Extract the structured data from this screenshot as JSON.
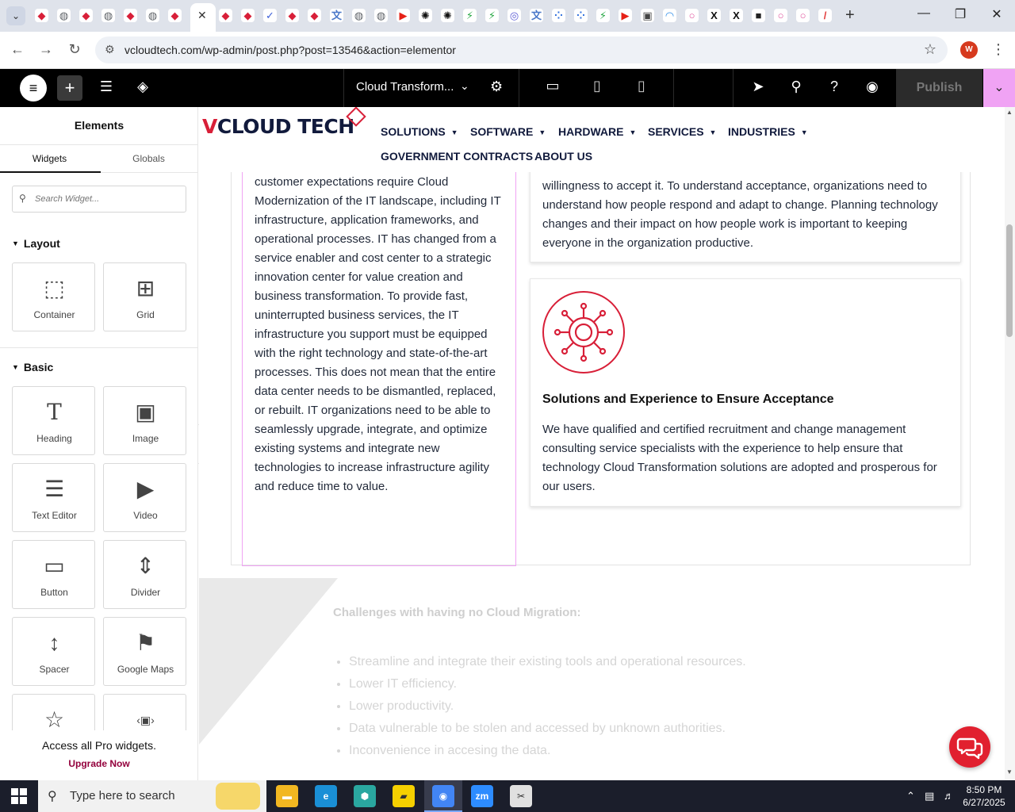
{
  "browser": {
    "url": "vcloudtech.com/wp-admin/post.php?post=13546&action=elementor",
    "profile_initial": "W",
    "tabs_favicons": [
      {
        "icon": "red-diamond-icon",
        "color": "#d81f38"
      },
      {
        "icon": "globe-icon",
        "color": "#5f6368"
      },
      {
        "icon": "red-diamond-icon",
        "color": "#d81f38"
      },
      {
        "icon": "globe-icon",
        "color": "#5f6368"
      },
      {
        "icon": "red-diamond-icon",
        "color": "#d81f38"
      },
      {
        "icon": "globe-icon",
        "color": "#5f6368"
      },
      {
        "icon": "red-diamond-icon",
        "color": "#d81f38"
      },
      {
        "icon": "red-diamond-icon",
        "color": "#d81f38"
      },
      {
        "icon": "red-diamond-icon",
        "color": "#d81f38"
      },
      {
        "icon": "check-icon",
        "color": "#3b5ed9"
      },
      {
        "icon": "red-diamond-icon",
        "color": "#d81f38"
      },
      {
        "icon": "red-diamond-icon",
        "color": "#d81f38"
      },
      {
        "icon": "translate-icon",
        "color": "#4a78c9"
      },
      {
        "icon": "globe-icon",
        "color": "#5f6368"
      },
      {
        "icon": "globe-icon",
        "color": "#5f6368"
      },
      {
        "icon": "youtube-icon",
        "color": "#e62117"
      },
      {
        "icon": "openai-icon",
        "color": "#111111"
      },
      {
        "icon": "openai-icon",
        "color": "#111111"
      },
      {
        "icon": "bolt-icon",
        "color": "#27a844"
      },
      {
        "icon": "bolt-icon",
        "color": "#27a844"
      },
      {
        "icon": "swirl-icon",
        "color": "#5b5bd6"
      },
      {
        "icon": "translate-icon",
        "color": "#4a78c9"
      },
      {
        "icon": "dots-icon",
        "color": "#2f6fde"
      },
      {
        "icon": "dots-icon",
        "color": "#2f6fde"
      },
      {
        "icon": "bolt-icon",
        "color": "#27a844"
      },
      {
        "icon": "youtube-icon",
        "color": "#e62117"
      },
      {
        "icon": "lock-icon",
        "color": "#444444"
      },
      {
        "icon": "arc-icon",
        "color": "#2d8ce8"
      },
      {
        "icon": "ring-icon",
        "color": "#e04f9c"
      },
      {
        "icon": "x-icon",
        "color": "#111111"
      },
      {
        "icon": "x-icon",
        "color": "#111111"
      },
      {
        "icon": "square-logo-icon",
        "color": "#222222"
      },
      {
        "icon": "ring-icon",
        "color": "#e04f9c"
      },
      {
        "icon": "ring-icon",
        "color": "#e04f9c"
      },
      {
        "icon": "slash-icon",
        "color": "#e23b3b"
      }
    ]
  },
  "editor": {
    "document_name": "Cloud Transform...",
    "publish_label": "Publish"
  },
  "panel": {
    "title": "Elements",
    "tabs": [
      "Widgets",
      "Globals"
    ],
    "search_placeholder": "Search Widget...",
    "sections": [
      {
        "label": "Layout",
        "widgets": [
          {
            "label": "Container",
            "icon": "container-icon"
          },
          {
            "label": "Grid",
            "icon": "grid-icon"
          }
        ]
      },
      {
        "label": "Basic",
        "widgets": [
          {
            "label": "Heading",
            "icon": "heading-icon"
          },
          {
            "label": "Image",
            "icon": "image-icon"
          },
          {
            "label": "Text Editor",
            "icon": "text-editor-icon"
          },
          {
            "label": "Video",
            "icon": "video-icon"
          },
          {
            "label": "Button",
            "icon": "button-icon"
          },
          {
            "label": "Divider",
            "icon": "divider-icon"
          },
          {
            "label": "Spacer",
            "icon": "spacer-icon"
          },
          {
            "label": "Google Maps",
            "icon": "google-maps-icon"
          }
        ]
      }
    ],
    "pro_text": "Access all Pro widgets.",
    "upgrade_label": "Upgrade Now"
  },
  "site": {
    "brand_v": "V",
    "brand_rest": "CLOUD TECH",
    "menu": [
      {
        "label": "SOLUTIONS",
        "has_caret": true
      },
      {
        "label": "SOFTWARE",
        "has_caret": true
      },
      {
        "label": "HARDWARE",
        "has_caret": true
      },
      {
        "label": "SERVICES",
        "has_caret": true
      },
      {
        "label": "INDUSTRIES",
        "has_caret": true
      },
      {
        "label": "GOVERNMENT CONTRACTS",
        "has_caret": false
      },
      {
        "label": "ABOUT US",
        "has_caret": false
      }
    ],
    "left_text": "customer expectations require Cloud Modernization of the IT landscape, including IT infrastructure, application frameworks, and operational processes. IT has changed from a service enabler and cost center to a strategic innovation center for value creation and business transformation. To provide fast, uninterrupted business services, the IT infrastructure you support must be equipped with the right technology and state-of-the-art processes. This does not mean that the entire data center needs to be dismantled, replaced, or rebuilt. IT organizations need to be able to seamlessly upgrade, integrate, and optimize existing systems and integrate new technologies to increase infrastructure agility and reduce time to value.",
    "card1_text": "willingness to accept it. To understand acceptance, organizations need to understand how people respond and adapt to change. Planning technology changes and their impact on how people work is important to keeping everyone in the organization productive.",
    "card2_title": "Solutions and Experience to Ensure Acceptance",
    "card2_text": "We have qualified and certified recruitment and change management consulting service specialists with the experience to help ensure that technology Cloud Transformation solutions are adopted and prosperous for our users.",
    "challenges_title": "Challenges with having no Cloud Migration:",
    "challenges": [
      "Streamline and integrate their existing tools and operational resources.",
      "Lower IT efficiency.",
      "Lower productivity.",
      "Data vulnerable to be stolen and accessed by unknown authorities.",
      "Inconvenience in accesing the data."
    ],
    "accent_color": "#d81f38",
    "navy_color": "#111a3c"
  },
  "taskbar": {
    "search_placeholder": "Type here to search",
    "time": "8:50 PM",
    "date": "6/27/2025",
    "apps": [
      {
        "name": "file-explorer-icon",
        "color": "#f2b721"
      },
      {
        "name": "edge-icon",
        "color": "#1a8fd6"
      },
      {
        "name": "app-hex-icon",
        "color": "#2aa7a0"
      },
      {
        "name": "sticky-notes-icon",
        "color": "#f5d000"
      },
      {
        "name": "chrome-icon",
        "color": "#4285f4"
      },
      {
        "name": "zoom-icon",
        "color": "#2d8cff"
      },
      {
        "name": "snipping-icon",
        "color": "#e0e0e0"
      }
    ]
  }
}
